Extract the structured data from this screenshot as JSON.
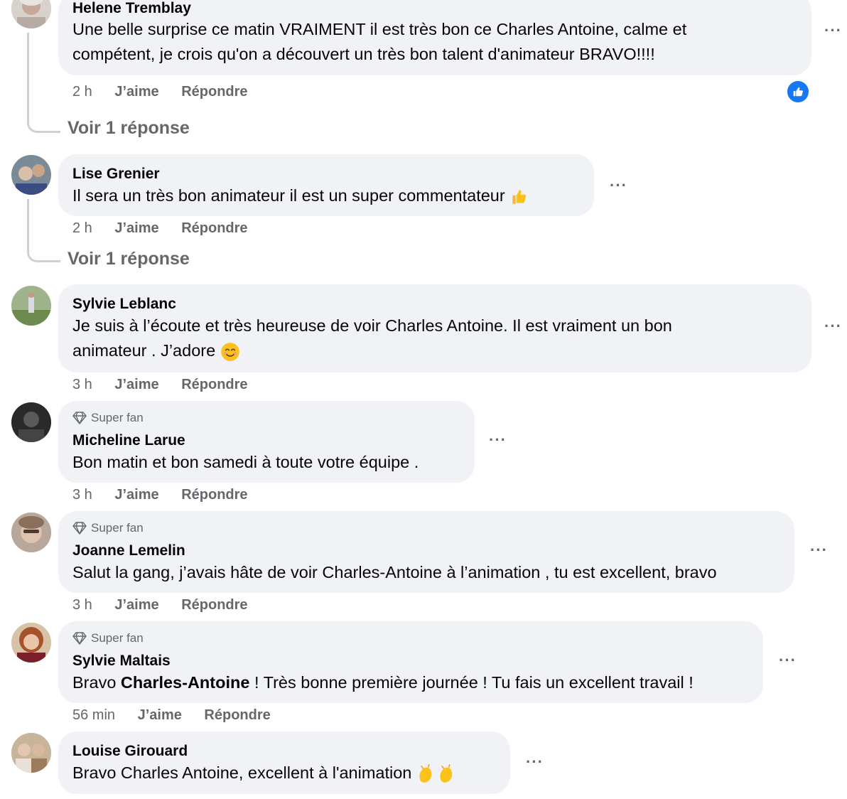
{
  "comments": [
    {
      "author": "Helene Tremblay",
      "lines": [
        "Une belle surprise ce matin VRAIMENT il est très bon ce Charles Antoine, calme et",
        "compétent, je crois qu'on a découvert un très bon talent d'animateur BRAVO!!!!"
      ],
      "time": "2 h",
      "like": "J’aime",
      "reply": "Répondre",
      "see_replies": "Voir 1 réponse",
      "reaction_icon": "like-icon"
    },
    {
      "author": "Lise Grenier",
      "lines": [
        "Il sera un très bon animateur il est un super commentateur"
      ],
      "emoji": "thumbs-up-emoji",
      "time": "2 h",
      "like": "J’aime",
      "reply": "Répondre",
      "see_replies": "Voir 1 réponse"
    },
    {
      "author": "Sylvie Leblanc",
      "lines": [
        "Je suis à l’écoute et très heureuse de voir Charles Antoine. Il est vraiment un bon",
        "animateur . J’adore"
      ],
      "emoji": "smiling-face-emoji",
      "time": "3 h",
      "like": "J’aime",
      "reply": "Répondre"
    },
    {
      "badge": "Super fan",
      "author": "Micheline Larue",
      "lines": [
        "Bon matin et bon samedi à toute votre équipe ."
      ],
      "time": "3 h",
      "like": "J’aime",
      "reply": "Répondre"
    },
    {
      "badge": "Super fan",
      "author": "Joanne Lemelin",
      "lines": [
        "Salut la gang, j’avais hâte de voir Charles-Antoine à l’animation , tu est excellent, bravo"
      ],
      "time": "3 h",
      "like": "J’aime",
      "reply": "Répondre"
    },
    {
      "badge": "Super fan",
      "author": "Sylvie Maltais",
      "mention": "Charles-Antoine",
      "text_before": "Bravo",
      "text_after": "! Très bonne première journée ! Tu fais un excellent travail !",
      "time": "56 min",
      "like": "J’aime",
      "reply": "Répondre"
    },
    {
      "author": "Louise Girouard",
      "lines": [
        "Bravo Charles Antoine, excellent à l'animation"
      ],
      "emoji": "clapping-hands-emoji",
      "time": "",
      "like": "",
      "reply": ""
    }
  ],
  "more_options": "···",
  "colors": {
    "bubble": "#f0f2f5",
    "secondary_text": "#65676b",
    "like_blue": "#1877f2"
  }
}
